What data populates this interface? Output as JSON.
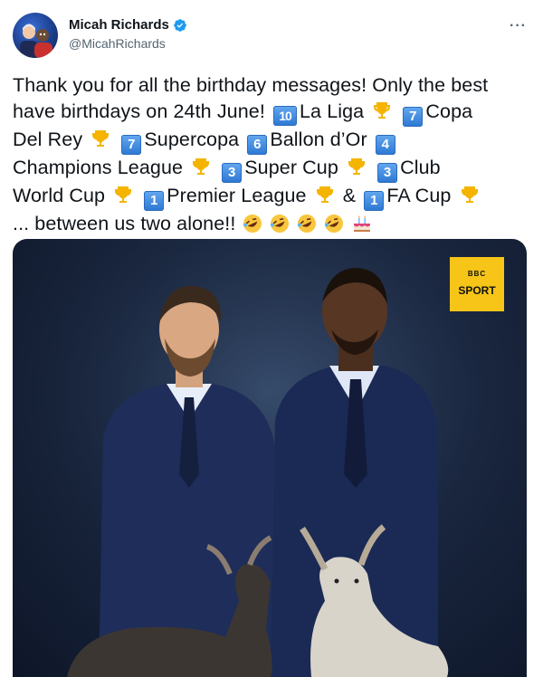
{
  "tweet": {
    "author_name": "Micah Richards",
    "author_handle": "@MicahRichards",
    "more_label": "···",
    "verified": true,
    "line1": "Thank you for all the birthday messages! Only the best",
    "line2_a": "have birthdays on 24th June!",
    "n10": "10",
    "la_liga": "La Liga",
    "n7a": "7",
    "copa": "Copa",
    "del_rey": "Del Rey",
    "n7b": "7",
    "supercopa": "Supercopa",
    "n6": "6",
    "ballon": "Ballon d’Or",
    "n4": "4",
    "champions": "Champions League",
    "n3a": "3",
    "super_cup": "Super Cup",
    "n3b": "3",
    "club": "Club",
    "world_cup": "World Cup",
    "n1a": "1",
    "premier": "Premier League",
    "amp": "&",
    "n1b": "1",
    "fa_cup": "FA Cup",
    "ending": "... between us two alone!!"
  },
  "media": {
    "badge_logo": "BBC",
    "badge_text": "SPORT"
  },
  "icons": {
    "avatar": "avatar",
    "verified": "verified-badge-icon",
    "trophy": "trophy-emoji-icon",
    "rofl": "rolling-laughing-emoji-icon",
    "cake": "birthday-cake-emoji-icon"
  },
  "colors": {
    "verified": "#1d9bf0",
    "text": "#0f1419",
    "secondary": "#536471",
    "badge": "#f6c518"
  }
}
